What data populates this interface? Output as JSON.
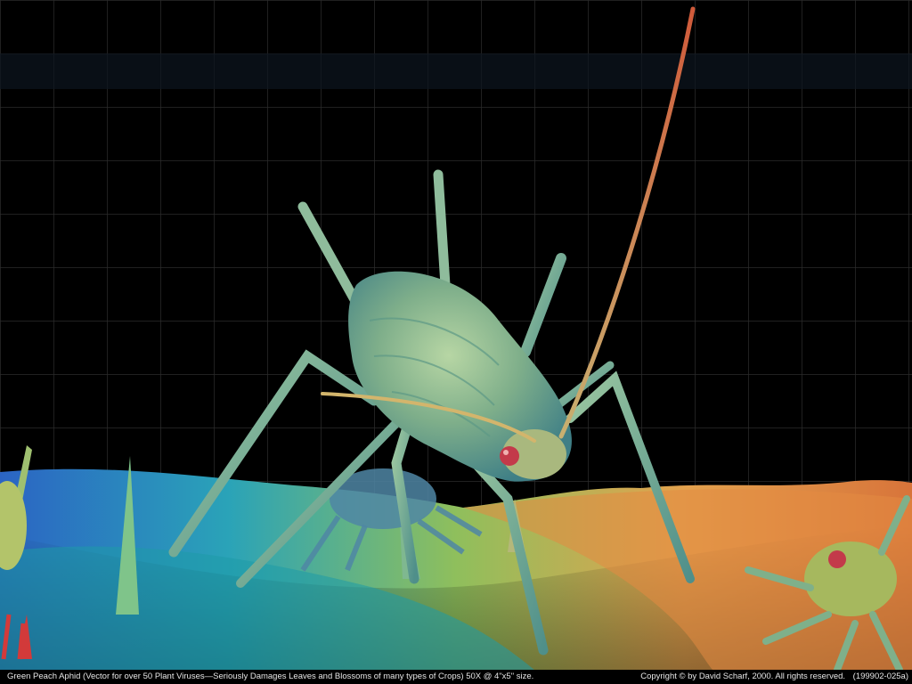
{
  "caption": {
    "title": "Green Peach Aphid (Vector for over 50 Plant Viruses—Seriously Damages Leaves and Blossoms of many types of Crops)",
    "magnification": "50X @ 4\"x5\" size.",
    "copyright": "Copyright © by David Scharf, 2000.  All rights reserved.",
    "catalog_id": "(199902-025a)"
  },
  "colors": {
    "background": "#000000",
    "grid": "#2a2a2a",
    "aphid_body": "#7fae8a",
    "leaf_warm": "#e39a4c",
    "leaf_cool": "#2f6fb0",
    "caption_text": "#e6e6e6"
  }
}
